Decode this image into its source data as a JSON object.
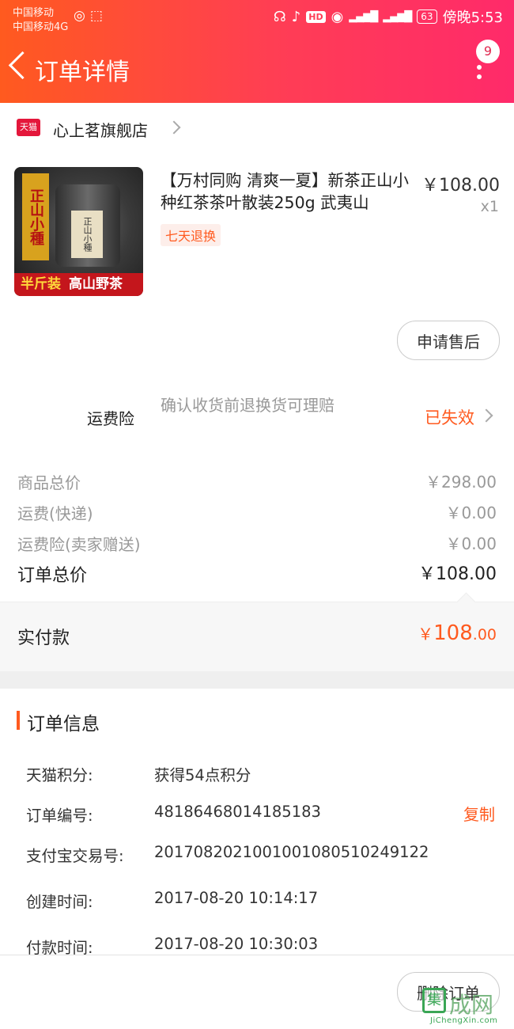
{
  "status_bar": {
    "carrier1": "中国移动",
    "carrier2": "中国移动4G",
    "battery": "63",
    "time": "傍晚5:53",
    "hd": "HD"
  },
  "header": {
    "title": "订单详情",
    "badge_count": "9"
  },
  "shop": {
    "platform_icon": "天猫",
    "name": "心上茗旗舰店"
  },
  "product": {
    "title": "【万村同购 清爽一夏】新茶正山小种红茶茶叶散装250g 武夷山",
    "price": "￥108.00",
    "qty": "x1",
    "tag": "七天退换",
    "image_text_vertical": "正山小種",
    "image_text_can": "正山小種",
    "image_text_strip_left": "半斤装",
    "image_text_strip_right": "高山野茶",
    "after_sale_button": "申请售后"
  },
  "insurance": {
    "label": "运费险",
    "description": "确认收货前退换货可理赔",
    "status": "已失效"
  },
  "price_breakdown": [
    {
      "label": "商品总价",
      "value": "￥298.00"
    },
    {
      "label": "运费(快递)",
      "value": "￥0.00"
    },
    {
      "label": "运费险(卖家赠送)",
      "value": "￥0.00"
    }
  ],
  "order_total": {
    "label": "订单总价",
    "value": "￥108.00"
  },
  "paid": {
    "label": "实付款",
    "currency": "￥",
    "integer": "108",
    "decimal": ".00"
  },
  "order_info": {
    "title": "订单信息",
    "rows": [
      {
        "label": "天猫积分:",
        "value": "获得54点积分"
      },
      {
        "label": "订单编号:",
        "value": "48186468014185183"
      },
      {
        "label": "支付宝交易号:",
        "value": "2017082021001001080510249122"
      },
      {
        "label": "创建时间:",
        "value": "2017-08-20 10:14:17"
      },
      {
        "label": "付款时间:",
        "value": "2017-08-20 10:30:03"
      }
    ],
    "copy_label": "复制"
  },
  "bottom": {
    "delete_button": "删除订单"
  },
  "watermark": {
    "logo": "集",
    "text": "成网",
    "url": "JiChengXin.com"
  },
  "colors": {
    "accent": "#ff5a1f",
    "header_start": "#ff5a1f",
    "header_end": "#ff2a6a",
    "tmall_red": "#e4173b"
  },
  "icons": [
    "back-arrow-icon",
    "more-dots-icon",
    "tmall-icon",
    "chevron-right-icon",
    "headphone-icon",
    "mute-icon",
    "eye-icon",
    "signal-icon",
    "battery-icon"
  ]
}
